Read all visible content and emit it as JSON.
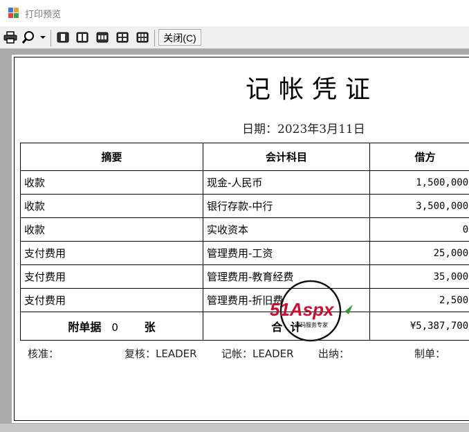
{
  "window": {
    "title": "打印预览"
  },
  "toolbar": {
    "close_label": "关闭(C)",
    "icons": [
      "printer-icon",
      "zoom-icon",
      "chevron-down-icon",
      "one-page-icon",
      "two-pages-icon",
      "three-pages-icon",
      "four-pages-icon",
      "six-pages-icon"
    ]
  },
  "voucher": {
    "title": "记帐凭证",
    "date_label": "日期：",
    "date_value": "2023年3月11日",
    "headers": [
      "摘要",
      "会计科目",
      "借方"
    ],
    "rows": [
      {
        "desc": "收款",
        "account": "现金-人民币",
        "debit": "1,500,000.0"
      },
      {
        "desc": "收款",
        "account": "银行存款-中行",
        "debit": "3,500,000.0"
      },
      {
        "desc": "收款",
        "account": "实收资本",
        "debit": "0.0"
      },
      {
        "desc": "支付费用",
        "account": "管理费用-工资",
        "debit": "25,000.0"
      },
      {
        "desc": "支付费用",
        "account": "管理费用-教育经费",
        "debit": "35,000.0"
      },
      {
        "desc": "支付费用",
        "account": "管理费用-折旧费",
        "debit": "2,500.0"
      }
    ],
    "attach_label": "附单据",
    "attach_count": "0",
    "attach_unit": "张",
    "total_label": "合  计",
    "total_debit": "¥5,387,700.0"
  },
  "footer": {
    "approve_label": "核准：",
    "review_label": "复核：",
    "review_value": "LEADER",
    "book_label": "记帐：",
    "book_value": "LEADER",
    "cashier_label": "出纳：",
    "maker_label": "制单："
  },
  "watermark": {
    "brand": "51Aspx",
    "tagline": "源码服务专家"
  }
}
